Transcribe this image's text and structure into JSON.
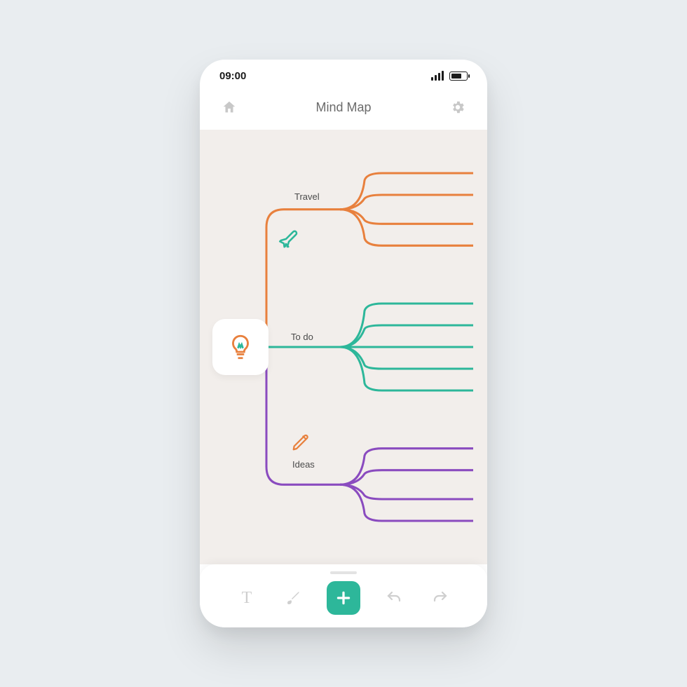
{
  "status": {
    "time": "09:00"
  },
  "header": {
    "title": "Mind Map"
  },
  "colors": {
    "orange": "#e8803d",
    "teal": "#2db79a",
    "purple": "#8a4bbf",
    "toolbar_accent": "#2db79a"
  },
  "mindmap": {
    "root_icon": "lightbulb-icon",
    "branches": [
      {
        "label": "Travel",
        "icon": "plane-icon",
        "color": "orange",
        "children": 4
      },
      {
        "label": "To do",
        "icon": null,
        "color": "teal",
        "children": 5
      },
      {
        "label": "Ideas",
        "icon": "pencil-icon",
        "color": "purple",
        "children": 4
      }
    ]
  },
  "toolbar": {
    "text_tool": "T",
    "items": [
      "text-tool",
      "brush-tool",
      "add-tool",
      "undo-tool",
      "redo-tool"
    ]
  }
}
